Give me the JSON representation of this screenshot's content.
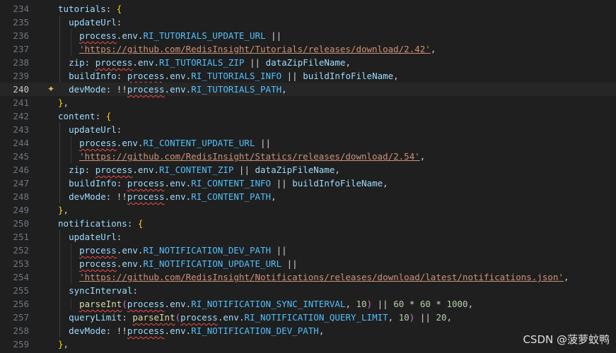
{
  "editor": {
    "current_line": 240,
    "lines": [
      {
        "n": "234",
        "t": [
          [
            "k",
            "tutorials"
          ],
          [
            "o",
            ": "
          ],
          [
            "b1",
            "{"
          ]
        ]
      },
      {
        "n": "235",
        "t": [
          [
            "o",
            "  "
          ],
          [
            "k",
            "updateUrl"
          ],
          [
            "o",
            ":"
          ]
        ]
      },
      {
        "n": "236",
        "t": [
          [
            "o",
            "    "
          ],
          [
            "k",
            "process"
          ],
          [
            "o",
            "."
          ],
          [
            "k",
            "env"
          ],
          [
            "o",
            "."
          ],
          [
            "c",
            "RI_TUTORIALS_UPDATE_URL"
          ],
          [
            "o",
            " ||"
          ]
        ]
      },
      {
        "n": "237",
        "t": [
          [
            "o",
            "    "
          ],
          [
            "s",
            "'https://github.com/RedisInsight/Tutorials/releases/download/2.42'"
          ],
          [
            "o",
            ","
          ]
        ]
      },
      {
        "n": "238",
        "t": [
          [
            "o",
            "  "
          ],
          [
            "k",
            "zip"
          ],
          [
            "o",
            ": "
          ],
          [
            "k",
            "process"
          ],
          [
            "o",
            "."
          ],
          [
            "k",
            "env"
          ],
          [
            "o",
            "."
          ],
          [
            "c",
            "RI_TUTORIALS_ZIP"
          ],
          [
            "o",
            " || "
          ],
          [
            "k",
            "dataZipFileName"
          ],
          [
            "o",
            ","
          ]
        ]
      },
      {
        "n": "239",
        "t": [
          [
            "o",
            "  "
          ],
          [
            "k",
            "buildInfo"
          ],
          [
            "o",
            ": "
          ],
          [
            "k",
            "process"
          ],
          [
            "o",
            "."
          ],
          [
            "k",
            "env"
          ],
          [
            "o",
            "."
          ],
          [
            "c",
            "RI_TUTORIALS_INFO"
          ],
          [
            "o",
            " || "
          ],
          [
            "k",
            "buildInfoFileName"
          ],
          [
            "o",
            ","
          ]
        ]
      },
      {
        "n": "240",
        "t": [
          [
            "o",
            "  "
          ],
          [
            "k",
            "devMode"
          ],
          [
            "o",
            ": !!"
          ],
          [
            "k",
            "process"
          ],
          [
            "o",
            "."
          ],
          [
            "k",
            "env"
          ],
          [
            "o",
            "."
          ],
          [
            "c",
            "RI_TUTORIALS_PATH"
          ],
          [
            "o",
            ","
          ]
        ]
      },
      {
        "n": "241",
        "t": [
          [
            "b1",
            "}"
          ],
          [
            "o",
            ","
          ]
        ]
      },
      {
        "n": "242",
        "t": [
          [
            "k",
            "content"
          ],
          [
            "o",
            ": "
          ],
          [
            "b1",
            "{"
          ]
        ]
      },
      {
        "n": "243",
        "t": [
          [
            "o",
            "  "
          ],
          [
            "k",
            "updateUrl"
          ],
          [
            "o",
            ":"
          ]
        ]
      },
      {
        "n": "244",
        "t": [
          [
            "o",
            "    "
          ],
          [
            "k",
            "process"
          ],
          [
            "o",
            "."
          ],
          [
            "k",
            "env"
          ],
          [
            "o",
            "."
          ],
          [
            "c",
            "RI_CONTENT_UPDATE_URL"
          ],
          [
            "o",
            " ||"
          ]
        ]
      },
      {
        "n": "245",
        "t": [
          [
            "o",
            "    "
          ],
          [
            "s",
            "'https://github.com/RedisInsight/Statics/releases/download/2.54'"
          ],
          [
            "o",
            ","
          ]
        ]
      },
      {
        "n": "246",
        "t": [
          [
            "o",
            "  "
          ],
          [
            "k",
            "zip"
          ],
          [
            "o",
            ": "
          ],
          [
            "k",
            "process"
          ],
          [
            "o",
            "."
          ],
          [
            "k",
            "env"
          ],
          [
            "o",
            "."
          ],
          [
            "c",
            "RI_CONTENT_ZIP"
          ],
          [
            "o",
            " || "
          ],
          [
            "k",
            "dataZipFileName"
          ],
          [
            "o",
            ","
          ]
        ]
      },
      {
        "n": "247",
        "t": [
          [
            "o",
            "  "
          ],
          [
            "k",
            "buildInfo"
          ],
          [
            "o",
            ": "
          ],
          [
            "k",
            "process"
          ],
          [
            "o",
            "."
          ],
          [
            "k",
            "env"
          ],
          [
            "o",
            "."
          ],
          [
            "c",
            "RI_CONTENT_INFO"
          ],
          [
            "o",
            " || "
          ],
          [
            "k",
            "buildInfoFileName"
          ],
          [
            "o",
            ","
          ]
        ]
      },
      {
        "n": "248",
        "t": [
          [
            "o",
            "  "
          ],
          [
            "k",
            "devMode"
          ],
          [
            "o",
            ": !!"
          ],
          [
            "k",
            "process"
          ],
          [
            "o",
            "."
          ],
          [
            "k",
            "env"
          ],
          [
            "o",
            "."
          ],
          [
            "c",
            "RI_CONTENT_PATH"
          ],
          [
            "o",
            ","
          ]
        ]
      },
      {
        "n": "249",
        "t": [
          [
            "b1",
            "}"
          ],
          [
            "o",
            ","
          ]
        ]
      },
      {
        "n": "250",
        "t": [
          [
            "k",
            "notifications"
          ],
          [
            "o",
            ": "
          ],
          [
            "b1",
            "{"
          ]
        ]
      },
      {
        "n": "251",
        "t": [
          [
            "o",
            "  "
          ],
          [
            "k",
            "updateUrl"
          ],
          [
            "o",
            ":"
          ]
        ]
      },
      {
        "n": "252",
        "t": [
          [
            "o",
            "    "
          ],
          [
            "k",
            "process"
          ],
          [
            "o",
            "."
          ],
          [
            "k",
            "env"
          ],
          [
            "o",
            "."
          ],
          [
            "c",
            "RI_NOTIFICATION_DEV_PATH"
          ],
          [
            "o",
            " ||"
          ]
        ]
      },
      {
        "n": "253",
        "t": [
          [
            "o",
            "    "
          ],
          [
            "k",
            "process"
          ],
          [
            "o",
            "."
          ],
          [
            "k",
            "env"
          ],
          [
            "o",
            "."
          ],
          [
            "c",
            "RI_NOTIFICATION_UPDATE_URL"
          ],
          [
            "o",
            " ||"
          ]
        ]
      },
      {
        "n": "254",
        "t": [
          [
            "o",
            "    "
          ],
          [
            "s",
            "'https://github.com/RedisInsight/Notifications/releases/download/latest/notifications.json'"
          ],
          [
            "o",
            ","
          ]
        ]
      },
      {
        "n": "255",
        "t": [
          [
            "o",
            "  "
          ],
          [
            "k",
            "syncInterval"
          ],
          [
            "o",
            ":"
          ]
        ]
      },
      {
        "n": "256",
        "t": [
          [
            "o",
            "    "
          ],
          [
            "f",
            "parseInt"
          ],
          [
            "b2",
            "("
          ],
          [
            "k",
            "process"
          ],
          [
            "o",
            "."
          ],
          [
            "k",
            "env"
          ],
          [
            "o",
            "."
          ],
          [
            "c",
            "RI_NOTIFICATION_SYNC_INTERVAL"
          ],
          [
            "o",
            ", "
          ],
          [
            "n",
            "10"
          ],
          [
            "b2",
            ")"
          ],
          [
            "o",
            " || "
          ],
          [
            "n",
            "60"
          ],
          [
            "o",
            " * "
          ],
          [
            "n",
            "60"
          ],
          [
            "o",
            " * "
          ],
          [
            "n",
            "1000"
          ],
          [
            "o",
            ","
          ]
        ]
      },
      {
        "n": "257",
        "t": [
          [
            "o",
            "  "
          ],
          [
            "k",
            "queryLimit"
          ],
          [
            "o",
            ": "
          ],
          [
            "f",
            "parseInt"
          ],
          [
            "b2",
            "("
          ],
          [
            "k",
            "process"
          ],
          [
            "o",
            "."
          ],
          [
            "k",
            "env"
          ],
          [
            "o",
            "."
          ],
          [
            "c",
            "RI_NOTIFICATION_QUERY_LIMIT"
          ],
          [
            "o",
            ", "
          ],
          [
            "n",
            "10"
          ],
          [
            "b2",
            ")"
          ],
          [
            "o",
            " || "
          ],
          [
            "n",
            "20"
          ],
          [
            "o",
            ","
          ]
        ]
      },
      {
        "n": "258",
        "t": [
          [
            "o",
            "  "
          ],
          [
            "k",
            "devMode"
          ],
          [
            "o",
            ": !!"
          ],
          [
            "k",
            "process"
          ],
          [
            "o",
            "."
          ],
          [
            "k",
            "env"
          ],
          [
            "o",
            "."
          ],
          [
            "c",
            "RI_NOTIFICATION_DEV_PATH"
          ],
          [
            "o",
            ","
          ]
        ]
      },
      {
        "n": "259",
        "t": [
          [
            "b1",
            "}"
          ],
          [
            "o",
            ","
          ]
        ]
      }
    ]
  },
  "watermark": "CSDN @菠萝蚊鸭",
  "icons": {
    "lightbulb": "lightbulb-icon"
  }
}
